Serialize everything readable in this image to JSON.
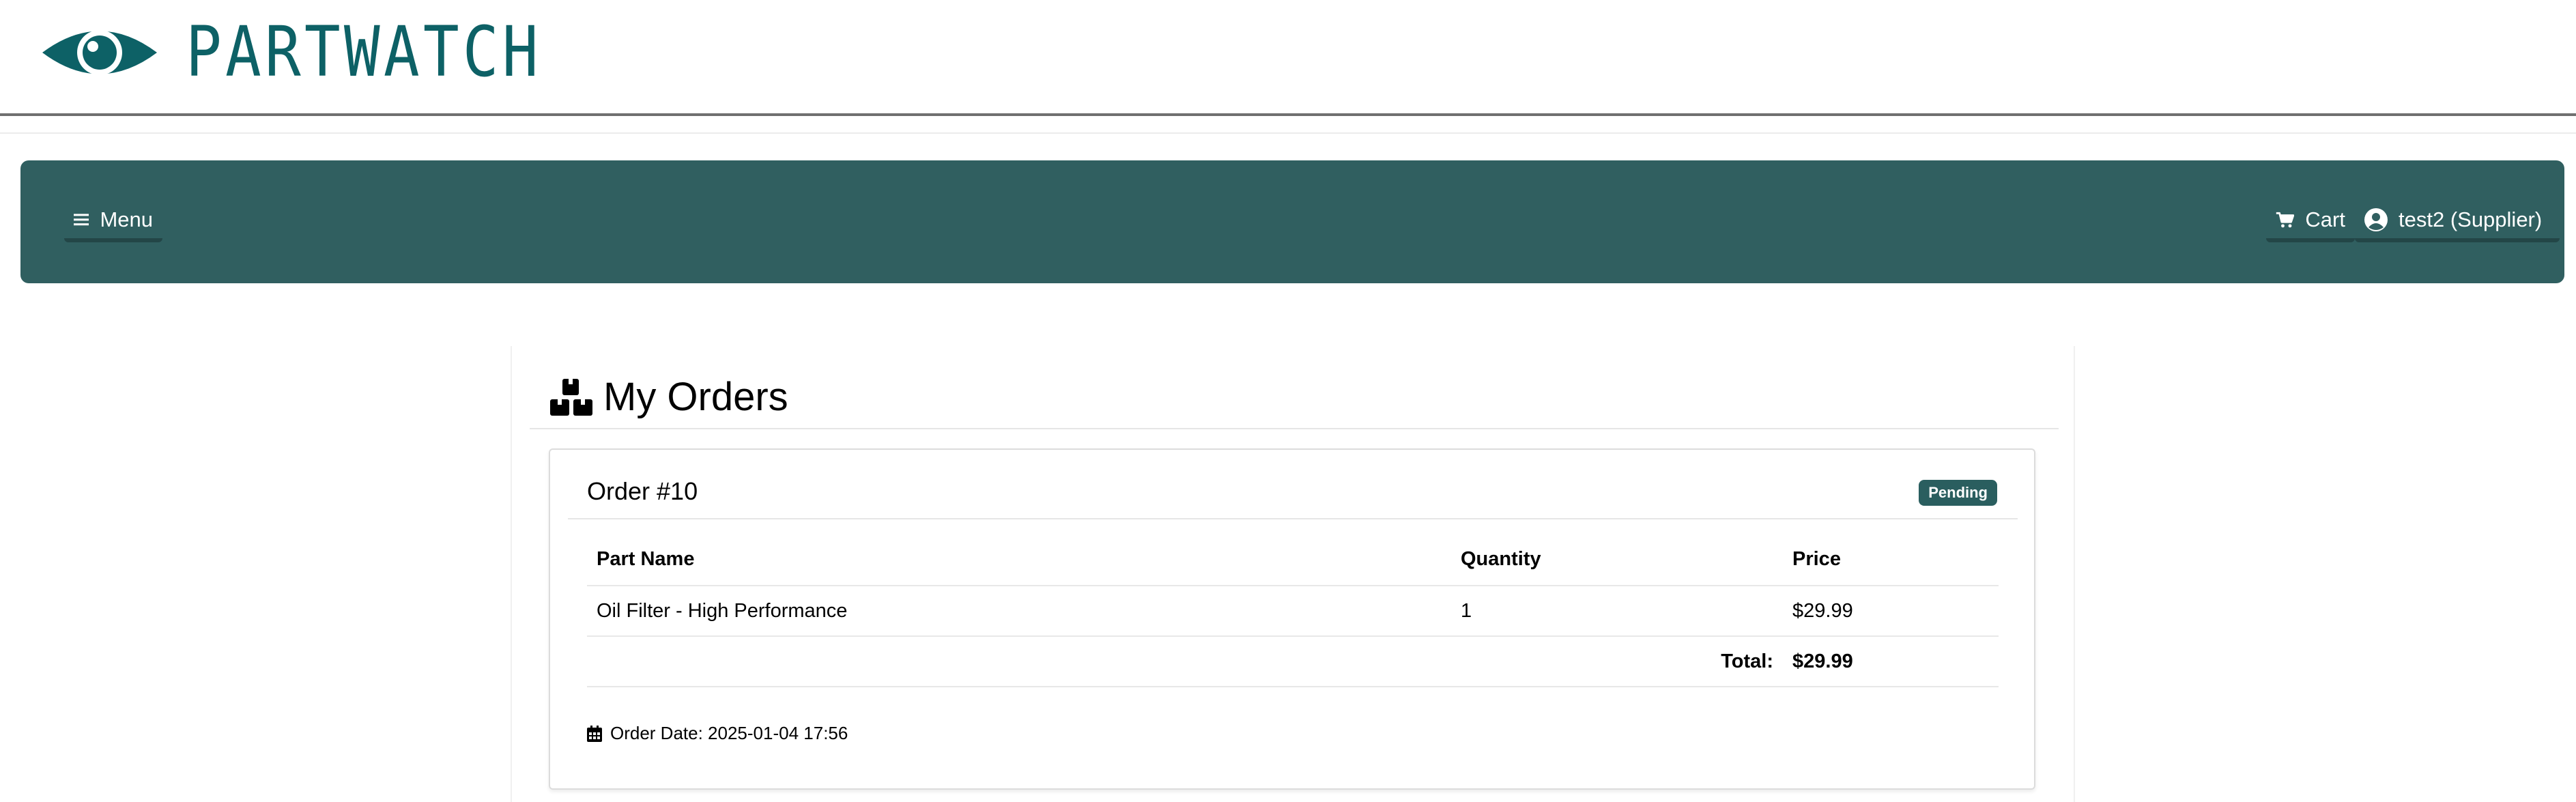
{
  "brand": {
    "name": "PARTWATCH",
    "color": "#0d6166"
  },
  "navbar": {
    "background": "#305f60",
    "menu_label": "Menu",
    "cart_label": "Cart",
    "user_label": "test2 (Supplier)"
  },
  "page": {
    "title": "My Orders"
  },
  "order": {
    "title": "Order #10",
    "status": "Pending",
    "columns": [
      "Part Name",
      "Quantity",
      "Price"
    ],
    "items": [
      {
        "part_name": "Oil Filter - High Performance",
        "quantity": "1",
        "price": "$29.99"
      }
    ],
    "total_label": "Total:",
    "total_value": "$29.99",
    "date_text": "Order Date: 2025-01-04 17:56"
  }
}
